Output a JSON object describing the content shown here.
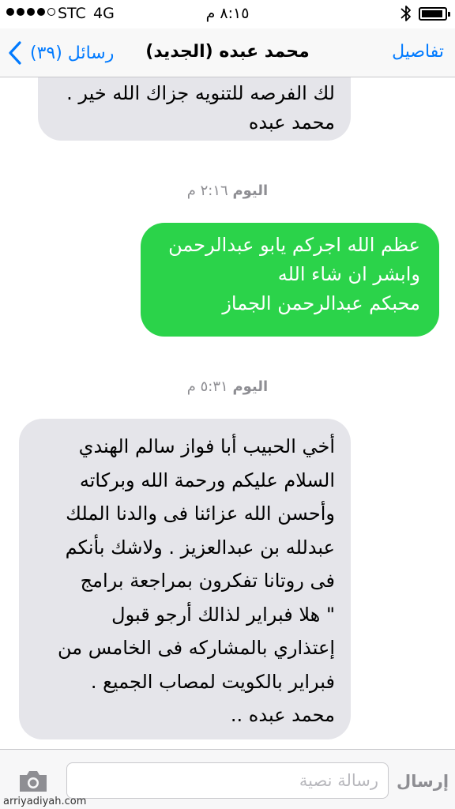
{
  "status_bar": {
    "carrier": "STC",
    "network": "4G",
    "time": "٨:١٥ م",
    "signal_bars_filled": 4,
    "signal_bars_total": 5
  },
  "nav": {
    "back_label": "رسائل (٣٩)",
    "title": "محمد عبده  (الجديد)",
    "details_label": "تفاصيل"
  },
  "conversation": {
    "top_message": {
      "lines": [
        "لك الفرصه للتنويه جزاك الله خير .",
        "محمد عبده"
      ]
    },
    "stamp1": {
      "day": "اليوم",
      "time": "٢:١٦ م"
    },
    "sent_message": {
      "lines": [
        "عظم الله اجركم يابو عبدالرحمن",
        "وابشر ان شاء الله",
        "محبكم عبدالرحمن الجماز"
      ]
    },
    "stamp2": {
      "day": "اليوم",
      "time": "٥:٣١ م"
    },
    "received_message": {
      "lines": [
        "أخي الحبيب أبا فواز سالم الهندي",
        "السلام عليكم ورحمة الله وبركاته",
        "وأحسن الله عزائنا فى والدنا الملك",
        "عبدلله بن عبدالعزيز . ولاشك بأنكم",
        "فى روتانا تفكرون بمراجعة  برامج",
        "\" هلا فبراير لذالك أرجو قبول",
        "إعتذاري بالمشاركه فى الخامس من",
        "فبراير بالكويت لمصاب الجميع .",
        "محمد عبده .."
      ]
    }
  },
  "input_bar": {
    "placeholder": "رسالة نصية",
    "send_label": "إرسال"
  },
  "watermark": "arriyadiyah.com",
  "colors": {
    "accent": "#007aff",
    "sent_bubble": "#2bd34a",
    "received_bubble": "#e5e5ea"
  }
}
